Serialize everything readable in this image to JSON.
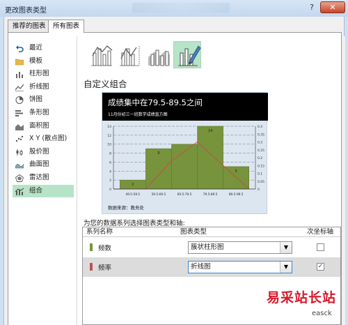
{
  "window": {
    "title": "更改图表类型",
    "help": "?",
    "close": "✕"
  },
  "tabs": [
    {
      "label": "推荐的图表"
    },
    {
      "label": "所有图表"
    }
  ],
  "sidebar": {
    "items": [
      {
        "label": "最近",
        "icon": "undo-icon"
      },
      {
        "label": "模板",
        "icon": "folder-icon"
      },
      {
        "label": "柱形图",
        "icon": "column-chart-icon"
      },
      {
        "label": "折线图",
        "icon": "line-chart-icon"
      },
      {
        "label": "饼图",
        "icon": "pie-chart-icon"
      },
      {
        "label": "条形图",
        "icon": "bar-chart-icon"
      },
      {
        "label": "面积图",
        "icon": "area-chart-icon"
      },
      {
        "label": "X Y (散点图)",
        "icon": "scatter-chart-icon"
      },
      {
        "label": "股价图",
        "icon": "stock-chart-icon"
      },
      {
        "label": "曲面图",
        "icon": "surface-chart-icon"
      },
      {
        "label": "雷达图",
        "icon": "radar-chart-icon"
      },
      {
        "label": "组合",
        "icon": "combo-chart-icon",
        "selected": true
      }
    ]
  },
  "section_title": "自定义组合",
  "preview": {
    "title": "成绩集中在79.5-89.5之间",
    "subtitle": "11月份初三一班数学成绩直方图",
    "source": "数据来源：教务处"
  },
  "chart_data": {
    "type": "bar",
    "categories": [
      "49.5-59.5",
      "59.5-69.5",
      "69.5-79.5",
      "79.5-89.5",
      "89.5-99.5"
    ],
    "y_tick_labels": [
      "0",
      "2",
      "4",
      "6",
      "8",
      "10",
      "12",
      "14"
    ],
    "y2_tick_labels": [
      "0",
      "0.05",
      "0.1",
      "0.15",
      "0.2",
      "0.25",
      "0.3",
      "0.35",
      "0.4"
    ],
    "ylim": [
      0,
      14
    ],
    "y2lim": [
      0,
      0.4
    ],
    "bar_fill": "#77933c",
    "line_color": "#c0504d",
    "series": [
      {
        "name": "频数",
        "type": "bar",
        "x": [
          2,
          9,
          10,
          14,
          5
        ],
        "values": [
          2,
          9,
          10,
          14,
          5
        ],
        "labels": [
          "2",
          "9",
          "",
          "14",
          "5"
        ]
      },
      {
        "name": "频率",
        "type": "line",
        "points": [
          [
            0,
            0
          ],
          [
            49.5,
            0
          ],
          [
            59.5,
            0
          ],
          [
            69.5,
            0.18
          ],
          [
            79.5,
            0.3
          ],
          [
            89.5,
            0.15
          ],
          [
            99.5,
            0.0
          ]
        ]
      }
    ]
  },
  "series_section": {
    "label": "为您的数据系列选择图表类型和轴:",
    "headers": {
      "name": "系列名称",
      "type": "图表类型",
      "axis": "次坐标轴"
    },
    "rows": [
      {
        "name": "频数",
        "color": "#77933c",
        "type": "簇状柱形图",
        "secondary": false
      },
      {
        "name": "频率",
        "color": "#c0504d",
        "type": "折线图",
        "secondary": true
      }
    ]
  },
  "watermark": {
    "text": "易采站长站",
    "sub": "easck"
  }
}
